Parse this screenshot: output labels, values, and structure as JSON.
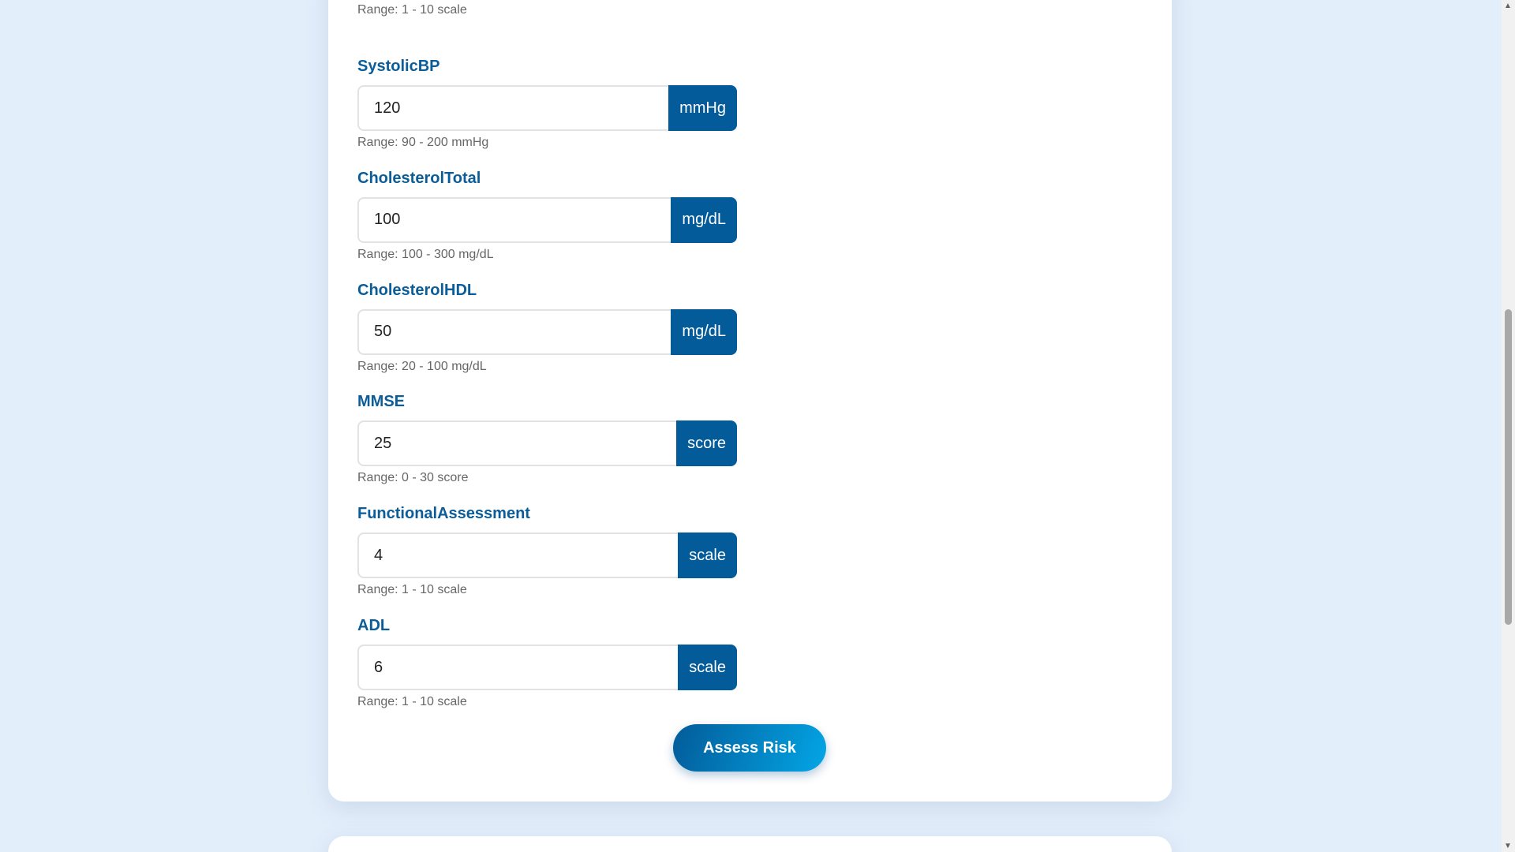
{
  "top_field": {
    "unit": "scale",
    "range": "Range: 1 - 10 scale"
  },
  "fields": [
    {
      "label": "SystolicBP",
      "value": "120",
      "unit": "mmHg",
      "range": "Range: 90 - 200 mmHg"
    },
    {
      "label": "CholesterolTotal",
      "value": "100",
      "unit": "mg/dL",
      "range": "Range: 100 - 300 mg/dL"
    },
    {
      "label": "CholesterolHDL",
      "value": "50",
      "unit": "mg/dL",
      "range": "Range: 20 - 100 mg/dL"
    },
    {
      "label": "MMSE",
      "value": "25",
      "unit": "score",
      "range": "Range: 0 - 30 score"
    },
    {
      "label": "FunctionalAssessment",
      "value": "4",
      "unit": "scale",
      "range": "Range: 1 - 10 scale"
    },
    {
      "label": "ADL",
      "value": "6",
      "unit": "scale",
      "range": "Range: 1 - 10 scale"
    }
  ],
  "submit_label": "Assess Risk"
}
